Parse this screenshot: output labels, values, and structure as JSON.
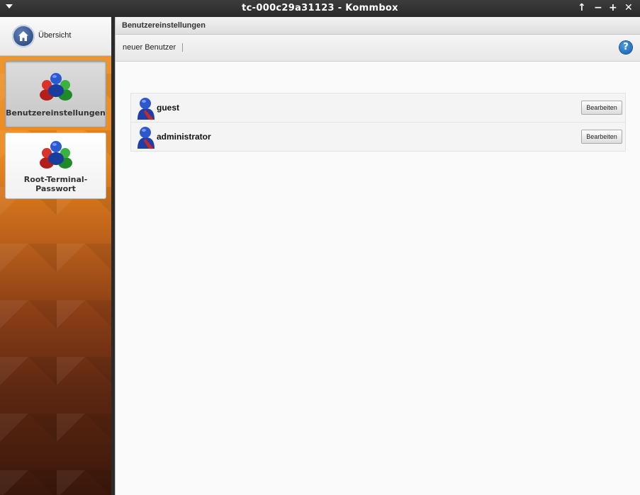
{
  "window": {
    "title": "tc-000c29a31123 - Kommbox"
  },
  "sidebar": {
    "home_label": "Übersicht",
    "items": [
      {
        "label": "Benutzereinstellungen",
        "icon": "users-group-icon",
        "active": true
      },
      {
        "label": "Root-Terminal-Passwort",
        "icon": "users-group-icon",
        "active": false
      }
    ]
  },
  "main": {
    "title": "Benutzereinstellungen",
    "toolbar": {
      "new_user": "neuer Benutzer",
      "help_icon": "?"
    },
    "users": [
      {
        "name": "guest",
        "button": "Bearbeiten"
      },
      {
        "name": "administrator",
        "button": "Bearbeiten"
      }
    ]
  },
  "colors": {
    "accent": "#eb8a1f",
    "titlebar": "#2f2f2f",
    "help": "#1f6fc4"
  }
}
